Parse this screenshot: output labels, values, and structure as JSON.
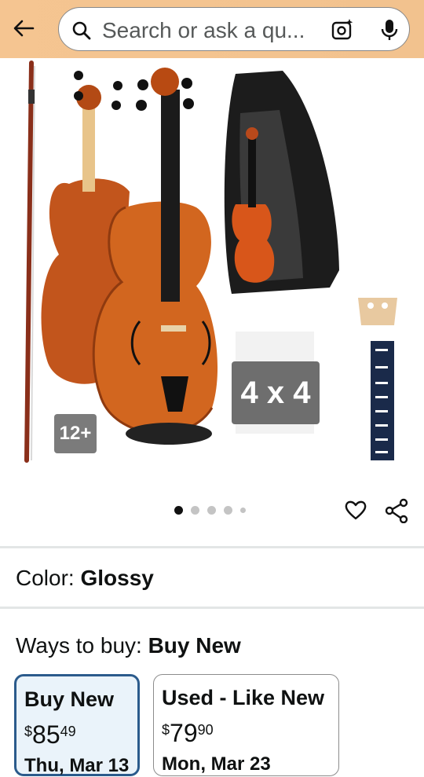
{
  "header": {
    "back_icon": "arrow-left-icon",
    "search_placeholder": "Search or ask a qu...",
    "icons": [
      "search-icon",
      "camera-lens-icon",
      "microphone-icon"
    ]
  },
  "gallery": {
    "more_images_badge": "12+",
    "size_badge": "4 x 4",
    "page_dots": 5,
    "active_dot": 1
  },
  "actions": {
    "icons": [
      "heart-icon",
      "share-icon"
    ]
  },
  "color": {
    "label": "Color: ",
    "value": "Glossy"
  },
  "ways_to_buy": {
    "label": "Ways to buy: ",
    "value": "Buy New",
    "options": [
      {
        "title": "Buy New",
        "currency": "$",
        "whole": "85",
        "fraction": "49",
        "cut_text": "Thu, Mar 13"
      },
      {
        "title": "Used - Like New",
        "currency": "$",
        "whole": "79",
        "fraction": "90",
        "cut_text": "Mon, Mar 23"
      }
    ]
  },
  "colors": {
    "header_bg": "#f5c591",
    "selected_border": "#2b5b8c",
    "selected_bg": "#eaf3fa"
  }
}
